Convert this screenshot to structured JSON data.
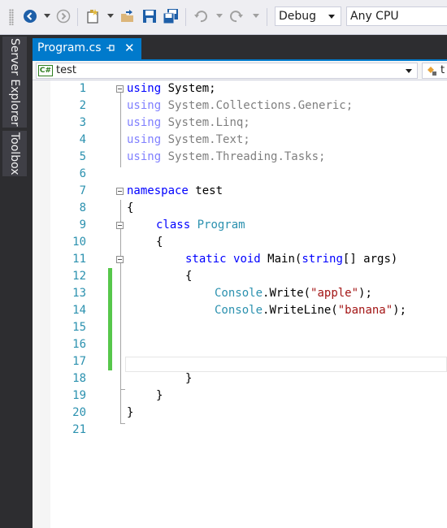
{
  "toolbar": {
    "configuration": "Debug",
    "platform": "Any CPU"
  },
  "side_panel": {
    "tabs": [
      "Server Explorer",
      "Toolbox"
    ]
  },
  "document_tab": {
    "title": "Program.cs",
    "pin_glyph": "⊣",
    "close_glyph": "✕"
  },
  "navigation_bar": {
    "project_badge": "C#",
    "project": "test",
    "member_partial": "t"
  },
  "editor": {
    "line_numbers": [
      "1",
      "2",
      "3",
      "4",
      "5",
      "6",
      "7",
      "8",
      "9",
      "10",
      "11",
      "12",
      "13",
      "14",
      "15",
      "16",
      "17",
      "18",
      "19",
      "20",
      "21"
    ],
    "changed_lines": [
      12,
      13,
      14,
      15,
      16,
      17
    ],
    "code": {
      "l1": [
        "using",
        " System;"
      ],
      "l2": [
        "using",
        " System.Collections.Generic;"
      ],
      "l3": [
        "using",
        " System.Linq;"
      ],
      "l4": [
        "using",
        " System.Text;"
      ],
      "l5": [
        "using",
        " System.Threading.Tasks;"
      ],
      "l7": [
        "namespace",
        " test"
      ],
      "l8": "{",
      "l9": [
        "class",
        " ",
        "Program"
      ],
      "l10": "{",
      "l11": [
        "static",
        " ",
        "void",
        " Main(",
        "string",
        "[] args)"
      ],
      "l12": "{",
      "l13": [
        "Console",
        ".Write(",
        "\"apple\"",
        ");"
      ],
      "l14": [
        "Console",
        ".WriteLine(",
        "\"banana\"",
        ");"
      ],
      "l18": "}",
      "l19": "}",
      "l20": "}"
    }
  },
  "colors": {
    "keyword": "#0000ff",
    "type": "#2b91af",
    "string": "#a31515",
    "line_number": "#2b91af",
    "change_bar": "#57c74b",
    "accent": "#007acc"
  }
}
